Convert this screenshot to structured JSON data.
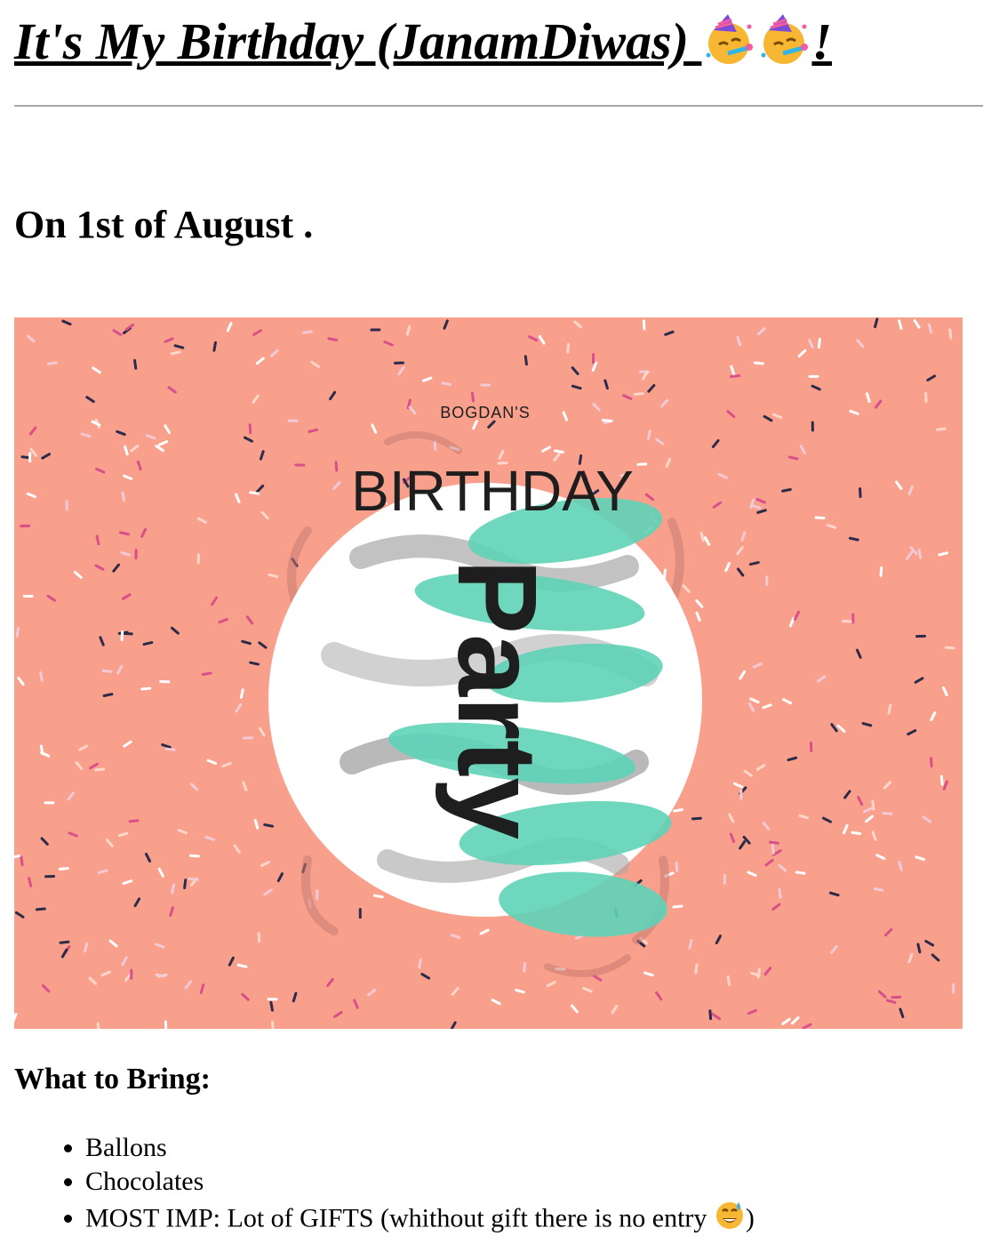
{
  "header": {
    "title_text": "It's My Birthday (JanamDiwas) ",
    "title_suffix": "!",
    "emoji_name": "partying-face-icon"
  },
  "event": {
    "date_text": "On 1st of August ."
  },
  "banner": {
    "subtitle": "BOGDAN'S",
    "title": "BIRTHDAY",
    "party_word": "Party",
    "colors": {
      "background": "#f9a08c",
      "circle": "#ffffff",
      "brush": "#5fd3b8",
      "text": "#1e1e1e"
    }
  },
  "bring": {
    "heading": "What to Bring:",
    "items": [
      "Ballons",
      "Chocolates",
      "MOST IMP: Lot of GIFTS (whithout gift there is no entry "
    ],
    "last_suffix": ")"
  }
}
